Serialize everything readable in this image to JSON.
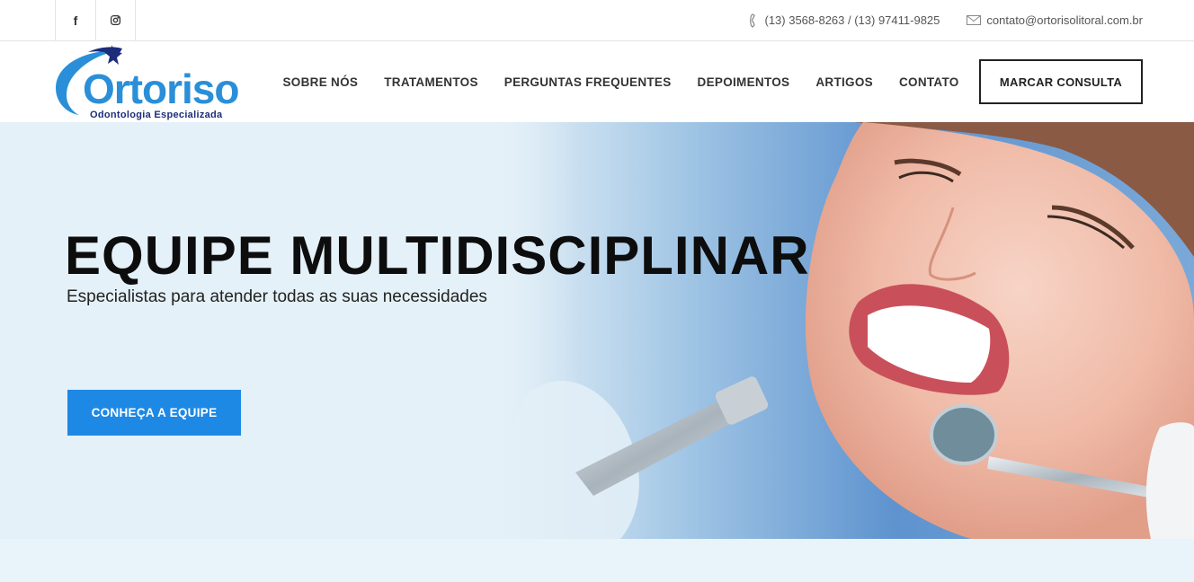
{
  "topbar": {
    "social": [
      {
        "icon": "facebook-icon",
        "glyph": "f"
      },
      {
        "icon": "instagram-icon",
        "glyph": ""
      }
    ],
    "phone_icon": "phone-icon",
    "phone": "(13) 3568-8263 / (13) 97411-9825",
    "email_icon": "envelope-icon",
    "email": "contato@ortorisolitoral.com.br"
  },
  "header": {
    "logo_name": "Ortoriso",
    "logo_tagline": "Odontologia Especializada",
    "nav": [
      "SOBRE NÓS",
      "TRATAMENTOS",
      "PERGUNTAS FREQUENTES",
      "DEPOIMENTOS",
      "ARTIGOS",
      "CONTATO"
    ],
    "cta": "MARCAR CONSULTA"
  },
  "hero": {
    "title": "EQUIPE MULTIDISCIPLINAR",
    "subtitle": "Especialistas para atender todas as suas necessidades",
    "button": "CONHEÇA A EQUIPE"
  },
  "colors": {
    "accent": "#1e88e5",
    "logo_blue": "#2a8fd8",
    "logo_navy": "#1d2d7a",
    "hero_bg": "#e5f1f8"
  }
}
